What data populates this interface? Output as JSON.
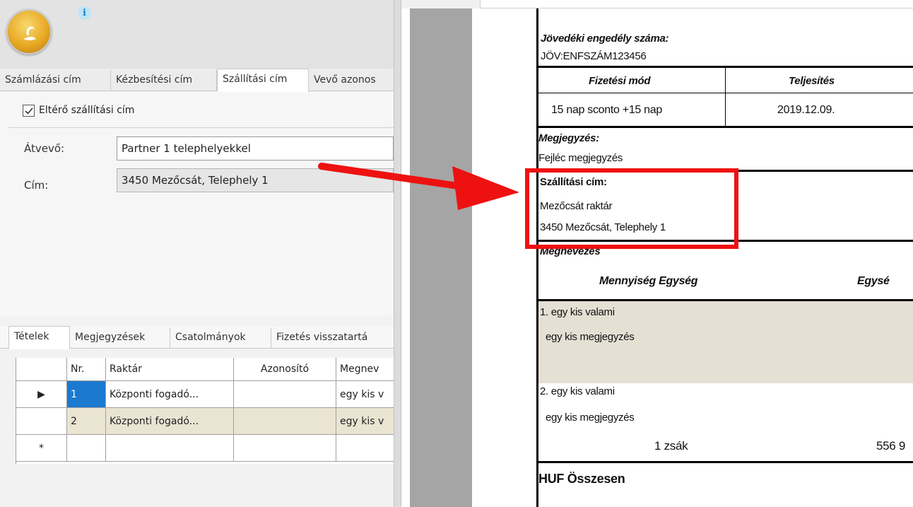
{
  "left": {
    "info_icon": "i",
    "top_tabs": [
      "Számlázási cím",
      "Kézbesítési cím",
      "Szállítási cím",
      "Vevő azonos"
    ],
    "active_top_tab": "Szállítási cím",
    "checkbox": {
      "label": "Eltérő szállítási cím",
      "checked": true
    },
    "fields": {
      "atvevo_label": "Átvevő:",
      "atvevo_value": "Partner 1 telephelyekkel",
      "cim_label": "Cím:",
      "cim_value": "3450 Mezőcsát, Telephely 1"
    },
    "bottom_tabs": [
      "Tételek",
      "Megjegyzések",
      "Csatolmányok",
      "Fizetés visszatartá"
    ],
    "active_bottom_tab": "Tételek",
    "grid": {
      "headers": [
        "",
        "Nr.",
        "Raktár",
        "Azonosító",
        "Megnev"
      ],
      "rows": [
        {
          "indicator": "▶",
          "nr": "1",
          "raktar": "Központi fogadó...",
          "azonosito": "",
          "megnev": "egy kis v"
        },
        {
          "indicator": "",
          "nr": "2",
          "raktar": "Központi fogadó...",
          "azonosito": "",
          "megnev": "egy kis v"
        },
        {
          "indicator": "*",
          "nr": "",
          "raktar": "",
          "azonosito": "",
          "megnev": ""
        }
      ]
    }
  },
  "document": {
    "excise_label": "Jövedéki engedély száma:",
    "excise_value": "JÖV:ENFSZÁM123456",
    "payment_header": "Fizetési mód",
    "payment_value": "15 nap sconto +15 nap",
    "fulfillment_header": "Teljesítés",
    "fulfillment_value": "2019.12.09.",
    "note_label": "Megjegyzés:",
    "note_value": "Fejléc megjegyzés",
    "shipping_label": "Szállítási cím:",
    "shipping_line1": "Mezőcsát raktár",
    "shipping_line2": "3450 Mezőcsát, Telephely 1",
    "name_header": "Megnevezés",
    "qty_unit_header": "Mennyiség Egység",
    "unit_price_header": "Egysé",
    "items": [
      {
        "title": "1. egy kis valami",
        "note": "egy kis megjegyzés"
      },
      {
        "title": "2. egy kis valami",
        "note": "egy kis megjegyzés",
        "qty": "1 zsák",
        "price": "556 9"
      }
    ],
    "total_label": "HUF Összesen"
  },
  "colors": {
    "highlight": "#ee1111",
    "grid_alt_row": "#eae4d3",
    "selection": "#1c79d0"
  }
}
